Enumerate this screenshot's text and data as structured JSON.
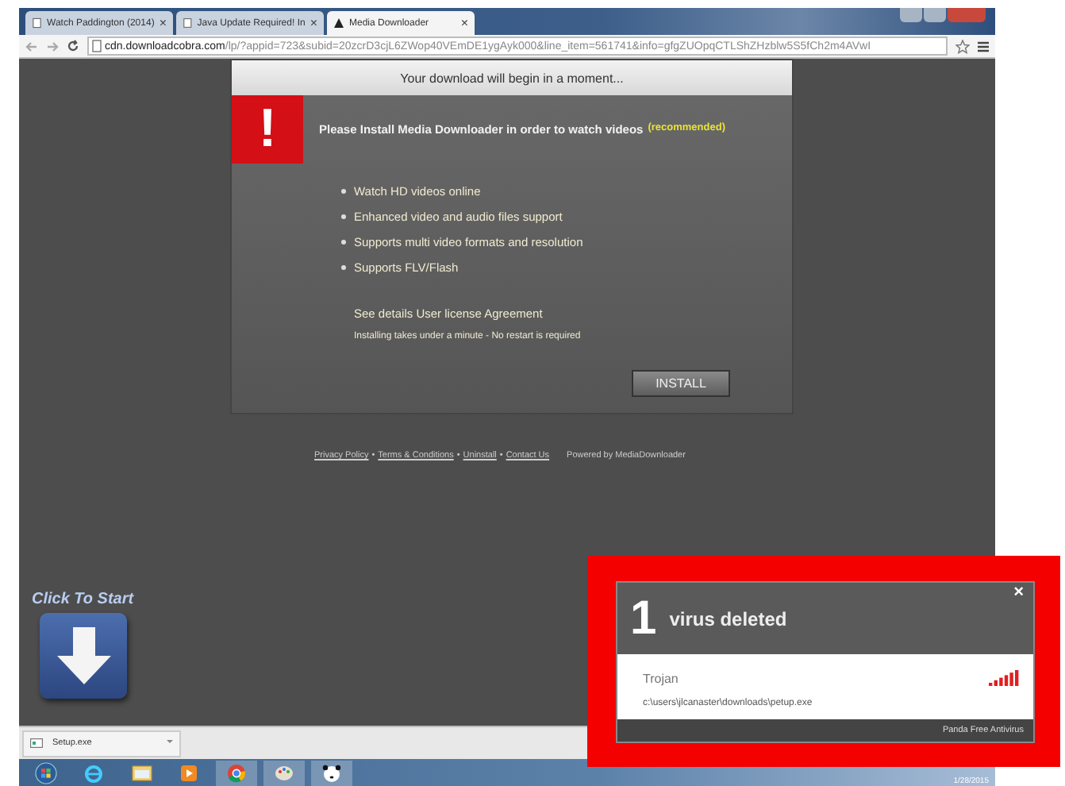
{
  "browser": {
    "tabs": [
      {
        "title": "Watch Paddington (2014)",
        "selected": false
      },
      {
        "title": "Java Update Required! In",
        "selected": false
      },
      {
        "title": "Media Downloader",
        "selected": true
      }
    ],
    "close_glyph": "×",
    "url_host": "cdn.downloadcobra.com",
    "url_path": "/lp/?appid=723&subid=20zcrD3cjL6ZWop40VEmDE1ygAyk000&line_item=561741&info=gfgZUOpqCTLShZHzblw5S5fCh2m4AVwI"
  },
  "dialog": {
    "header": "Your download will begin in a moment...",
    "alert_glyph": "!",
    "title": "Please Install Media Downloader in order to watch videos",
    "tag": "(recommended)",
    "features": [
      "Watch HD videos online",
      "Enhanced video and audio files support",
      "Supports multi video formats and resolution",
      "Supports FLV/Flash"
    ],
    "license": "See details User license Agreement",
    "note": "Installing takes under a minute - No restart is required",
    "button": "INSTALL"
  },
  "footer": {
    "links": [
      "Privacy Policy",
      "Terms & Conditions",
      "Uninstall",
      "Contact Us"
    ],
    "separator": "•",
    "powered": "Powered by MediaDownloader"
  },
  "start": {
    "label": "Click To Start"
  },
  "downloads": {
    "file": "Setup.exe"
  },
  "taskbar": {
    "date": "1/28/2015"
  },
  "alert": {
    "count": "1",
    "title": "virus deleted",
    "close": "×",
    "threat": "Trojan",
    "path": "c:\\users\\jlcanaster\\downloads\\petup.exe",
    "product": "Panda Free Antivirus"
  }
}
